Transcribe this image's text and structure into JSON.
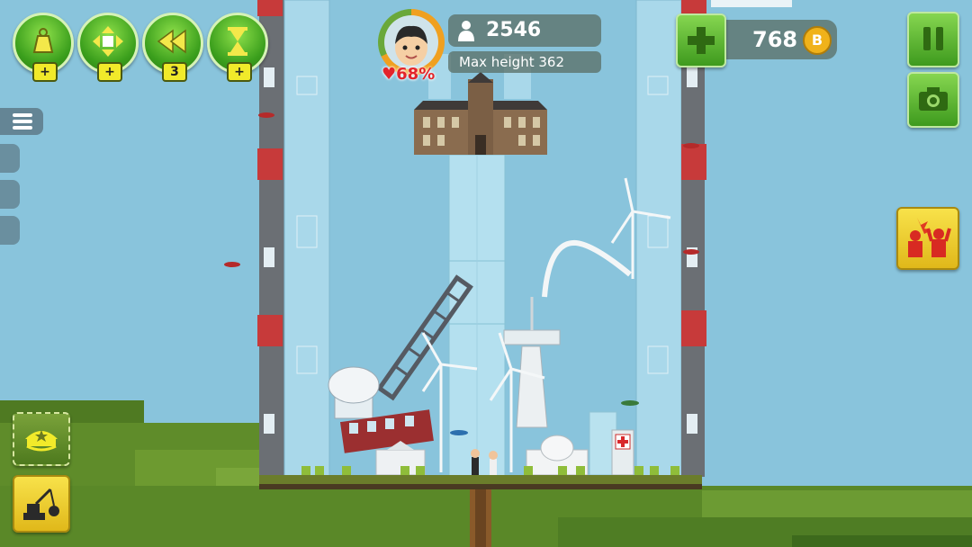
{
  "colors": {
    "sky": "#89c4dc",
    "button_green": "#4caf22",
    "badge_yellow": "#f1ea2a",
    "heart_red": "#e3242b",
    "coin_gold": "#f0b21a"
  },
  "powerups": [
    {
      "icon": "weight-icon",
      "badge": "+"
    },
    {
      "icon": "move-arrows-icon",
      "badge": "+"
    },
    {
      "icon": "rewind-icon",
      "badge": "3"
    },
    {
      "icon": "hourglass-icon",
      "badge": "+"
    }
  ],
  "stats": {
    "population": "2546",
    "max_height": "Max height 362",
    "happiness": "68%"
  },
  "currency": {
    "coins": "768",
    "coin_letter": "B",
    "add_icon": "plus-icon"
  },
  "right_buttons": [
    "pause-icon",
    "camera-icon",
    "riot-event-icon"
  ],
  "left_buttons": [
    "menu-icon",
    "police-cap-icon",
    "demolish-crane-icon"
  ]
}
